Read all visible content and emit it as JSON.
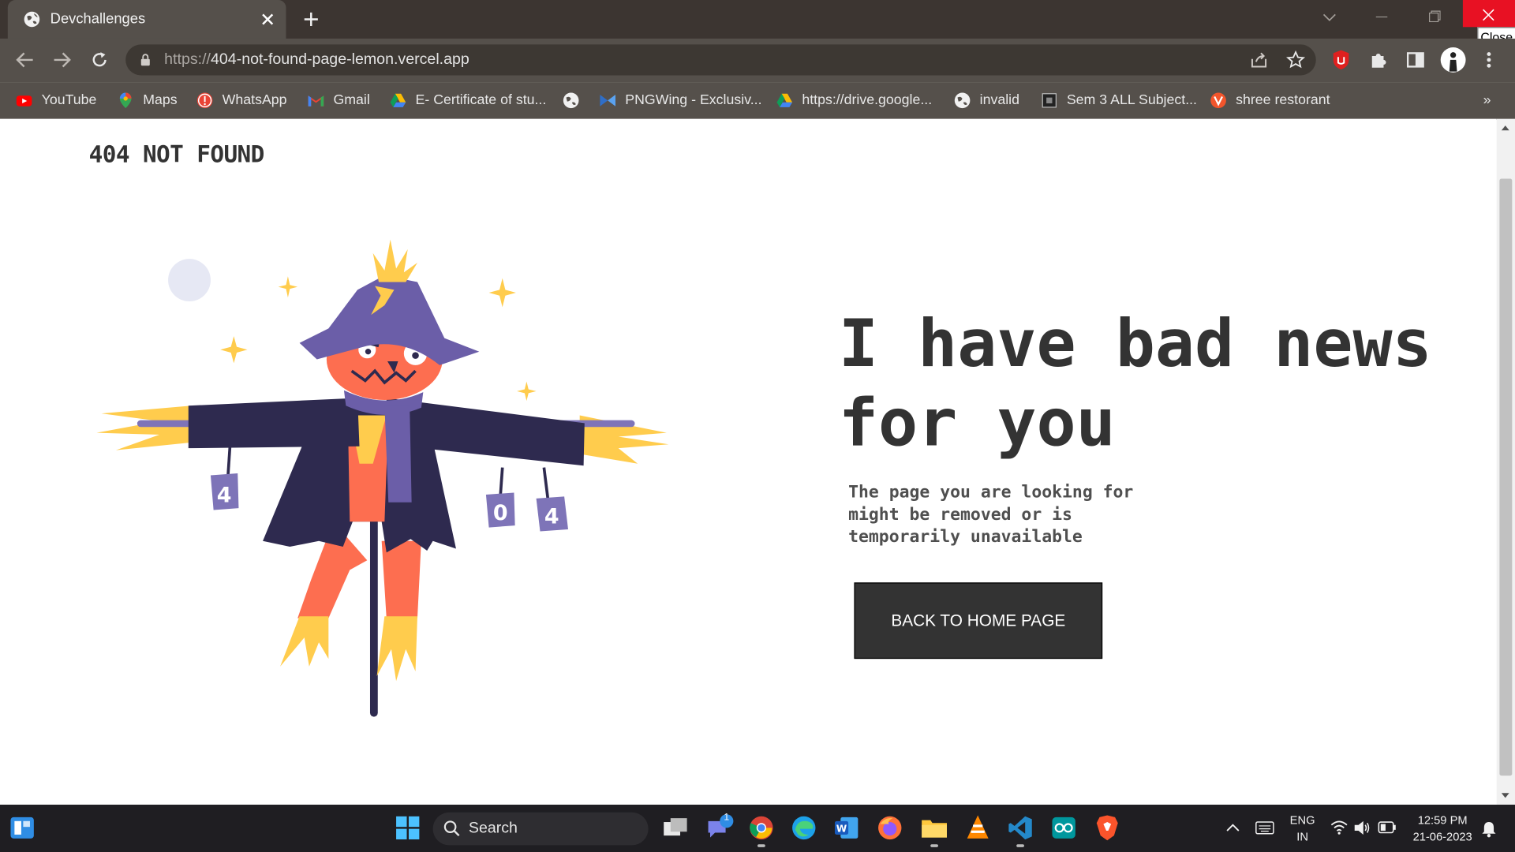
{
  "browser": {
    "tab_title": "Devchallenges",
    "url_scheme": "https://",
    "url_rest": "404-not-found-page-lemon.vercel.app",
    "tooltip": "Close",
    "bookmarks": [
      {
        "label": "YouTube",
        "icon": "youtube-icon",
        "color": "#ff0000"
      },
      {
        "label": "Maps",
        "icon": "maps-icon",
        "color": "#34a853"
      },
      {
        "label": "WhatsApp",
        "icon": "whatsapp-icon",
        "color": "#ea4335"
      },
      {
        "label": "Gmail",
        "icon": "gmail-icon",
        "color": "#ea4335"
      },
      {
        "label": "E- Certificate of stu...",
        "icon": "drive-icon",
        "color": "#fbbc04"
      },
      {
        "label": "",
        "icon": "globe-icon",
        "color": "#ffffff"
      },
      {
        "label": "PNGWing - Exclusiv...",
        "icon": "pngwing-icon",
        "color": "#4a90e2"
      },
      {
        "label": "https://drive.google...",
        "icon": "drive-icon",
        "color": "#fbbc04"
      },
      {
        "label": "invalid",
        "icon": "globe-icon",
        "color": "#ffffff"
      },
      {
        "label": "Sem 3 ALL Subject...",
        "icon": "doc-icon",
        "color": "#222222"
      },
      {
        "label": "shree restorant",
        "icon": "restaurant-icon",
        "color": "#f2552c"
      }
    ],
    "more_bookmarks": "»"
  },
  "page": {
    "logo": "404 NOT FOUND",
    "headline": "I have bad news for you",
    "description": "The page you are looking for might be removed or is temporarily unavailable",
    "button_label": "BACK TO HOME PAGE",
    "cans": [
      "4",
      "0",
      "4"
    ]
  },
  "taskbar": {
    "search_label": "Search",
    "lang_top": "ENG",
    "lang_bottom": "IN",
    "time": "12:59 PM",
    "date": "21-06-2023",
    "teams_badge": "1"
  },
  "colors": {
    "title_bar": "#3c3531",
    "toolbar": "#55504b",
    "button_bg": "#333333",
    "close_red": "#e81123",
    "scarecrow_coat": "#2e2a4f",
    "scarecrow_hat": "#6b5ea8",
    "pumpkin": "#fd6e50",
    "straw": "#ffcc4d"
  }
}
